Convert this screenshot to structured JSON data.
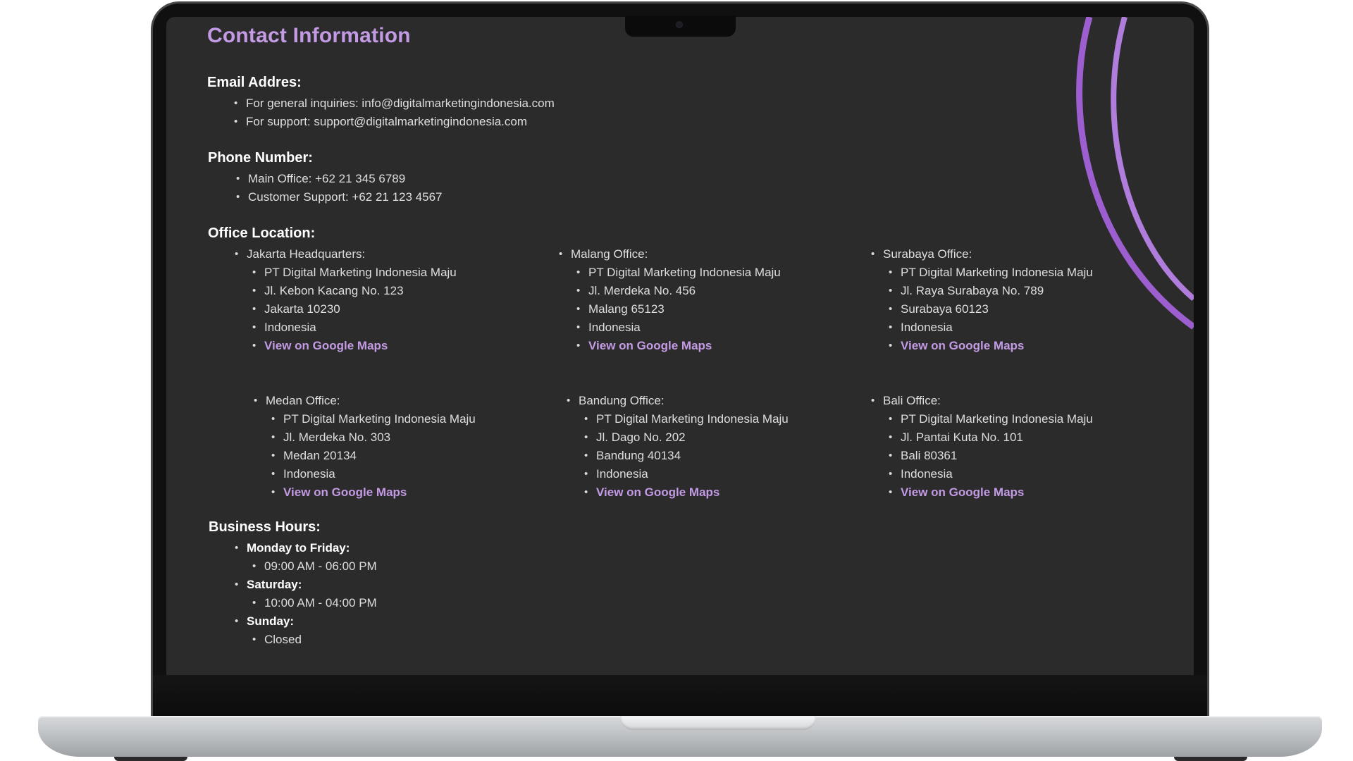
{
  "page_title": "Contact Information",
  "email": {
    "heading": "Email Addres:",
    "items": [
      "For general inquiries: info@digitalmarketingindonesia.com",
      "For support: support@digitalmarketingindonesia.com"
    ]
  },
  "phone": {
    "heading": "Phone Number:",
    "items": [
      "Main Office: +62 21 345 6789",
      "Customer Support: +62 21 123 4567"
    ]
  },
  "office": {
    "heading": "Office Location:",
    "offices": [
      {
        "name": "Jakarta Headquarters:",
        "lines": [
          "PT Digital Marketing Indonesia Maju",
          "Jl. Kebon Kacang No. 123",
          "Jakarta 10230",
          "Indonesia"
        ],
        "link": "View on Google Maps"
      },
      {
        "name": "Malang Office:",
        "lines": [
          "PT Digital Marketing Indonesia Maju",
          "Jl. Merdeka No. 456",
          "Malang 65123",
          "Indonesia"
        ],
        "link": "View on Google Maps"
      },
      {
        "name": "Surabaya Office:",
        "lines": [
          "PT Digital Marketing Indonesia Maju",
          "Jl. Raya Surabaya No. 789",
          "Surabaya 60123",
          "Indonesia"
        ],
        "link": "View on Google Maps"
      },
      {
        "name": "Medan Office:",
        "lines": [
          "PT Digital Marketing Indonesia Maju",
          "Jl. Merdeka No. 303",
          "Medan 20134",
          "Indonesia"
        ],
        "link": "View on Google Maps"
      },
      {
        "name": "Bandung Office:",
        "lines": [
          "PT Digital Marketing Indonesia Maju",
          "Jl. Dago No. 202",
          "Bandung 40134",
          "Indonesia"
        ],
        "link": "View on Google Maps"
      },
      {
        "name": "Bali Office:",
        "lines": [
          "PT Digital Marketing Indonesia Maju",
          "Jl. Pantai Kuta No. 101",
          "Bali 80361",
          "Indonesia"
        ],
        "link": "View on Google Maps"
      }
    ]
  },
  "hours": {
    "heading": "Business Hours:",
    "groups": [
      {
        "day": "Monday to Friday:",
        "time": "09:00 AM - 06:00 PM"
      },
      {
        "day": "Saturday:",
        "time": "10:00 AM - 04:00 PM"
      },
      {
        "day": "Sunday:",
        "time": "Closed"
      }
    ]
  },
  "colors": {
    "accent": "#c39ae4",
    "screen_bg": "#2b2b2b",
    "arc": "#a56ad6"
  }
}
